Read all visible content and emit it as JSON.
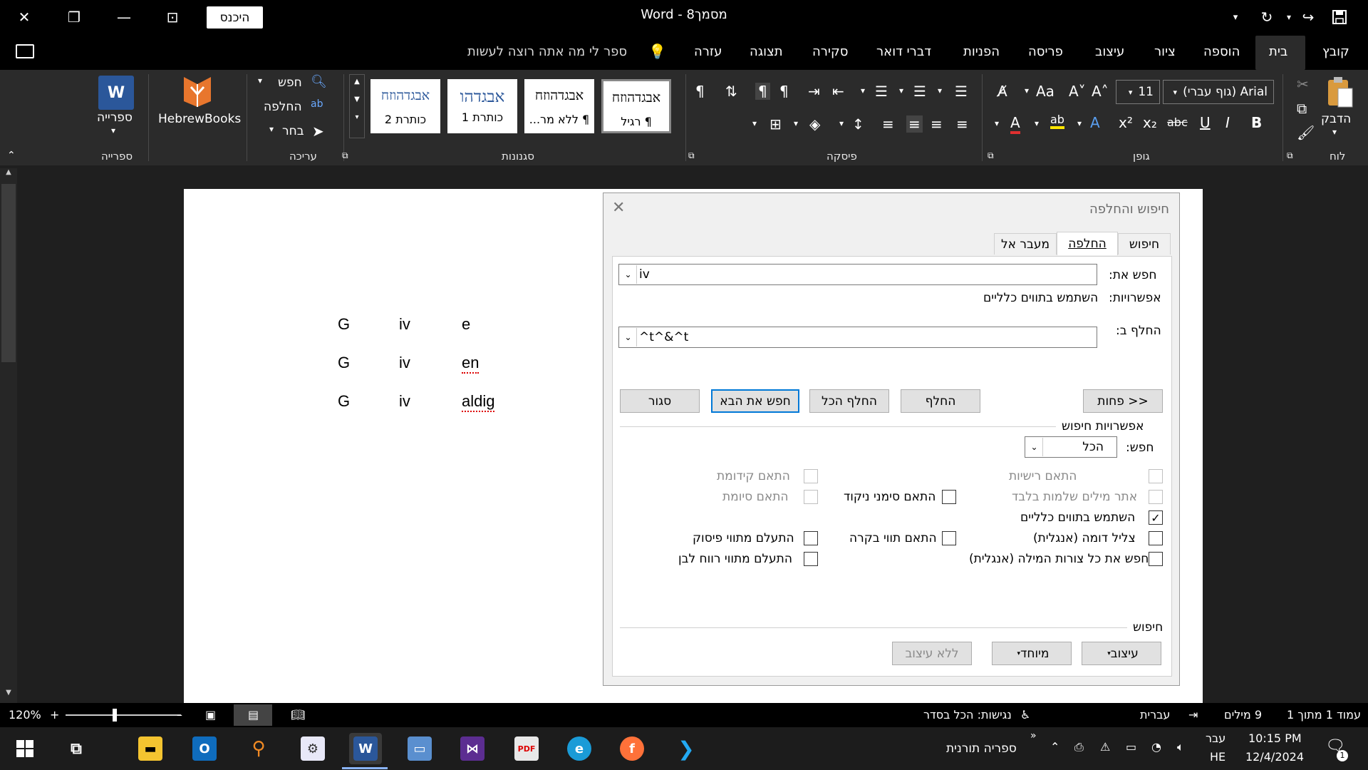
{
  "titlebar": {
    "signin": "היכנס",
    "title": "מסמך8  -  Word"
  },
  "tabs": {
    "file": "קובץ",
    "home": "בית",
    "insert": "הוספה",
    "draw": "ציור",
    "design": "עיצוב",
    "layout": "פריסה",
    "references": "הפניות",
    "mailings": "דברי דואר",
    "review": "סקירה",
    "view": "תצוגה",
    "help": "עזרה",
    "tellme": "ספר לי מה אתה רוצה לעשות"
  },
  "ribbon": {
    "groups": {
      "clipboard": "לוח",
      "font": "גופן",
      "paragraph": "פיסקה",
      "styles": "סגנונות",
      "editing": "עריכה",
      "library": "ספרייה"
    },
    "paste": "הדבק",
    "font_name": "Arial (גוף עברי)",
    "font_size": "11",
    "styles": [
      {
        "preview": "אבגדהוזח",
        "name": "¶ רגיל"
      },
      {
        "preview": "אבגדהוזח",
        "name": "¶ ללא מר..."
      },
      {
        "preview": "אבגדהו",
        "name": "כותרת 1"
      },
      {
        "preview": "אבגדהוזח",
        "name": "כותרת 2"
      }
    ],
    "find": "חפש",
    "replace": "החלפה",
    "select": "בחר",
    "hebrewbooks": "HebrewBooks",
    "library_btn": "ספרייה"
  },
  "document": {
    "rows": [
      [
        "G",
        "iv",
        "e"
      ],
      [
        "G",
        "iv",
        "en"
      ],
      [
        "G",
        "iv",
        "aldig"
      ]
    ]
  },
  "dialog": {
    "title": "חיפוש והחלפה",
    "tabs": {
      "find": "חיפוש",
      "replace": "החלפה",
      "goto": "מעבר אל"
    },
    "find_label": "חפש את:",
    "find_value": "iv",
    "options_label": "אפשרויות:",
    "options_value": "השתמש בתווים כלליים",
    "replace_label": "החלף ב:",
    "replace_value": "^t^&^t",
    "buttons": {
      "less": "<< פחות",
      "replace": "החלף",
      "replace_all": "החלף הכל",
      "find_next": "חפש את הבא",
      "close": "סגור"
    },
    "search_options_title": "אפשרויות חיפוש",
    "search_label": "חפש:",
    "search_value": "הכל",
    "checks": {
      "match_case": "התאם רישיות",
      "whole_words": "אתר מילים שלמות בלבד",
      "wildcards": "השתמש בתווים כלליים",
      "sounds_like": "צליל דומה (אנגלית)",
      "all_forms": "חפש את כל צורות המילה (אנגלית)",
      "match_prefix": "התאם קידומת",
      "match_suffix": "התאם סיומת",
      "match_punct": "התאם סימני ניקוד",
      "match_kashida": "התאם תווי בקרה",
      "ignore_punct": "התעלם מתווי פיסוק",
      "ignore_space": "התעלם מתווי רווח לבן"
    },
    "find_section": "חיפוש",
    "bottom": {
      "format": "עיצוב",
      "special": "מיוחד",
      "no_format": "ללא עיצוב"
    }
  },
  "status": {
    "page": "עמוד 1 מתוך 1",
    "words": "9 מילים",
    "language": "עברית",
    "accessibility": "נגישות: הכל בסדר",
    "zoom": "120%"
  },
  "taskbar": {
    "torah_lib": "ספריה תורנית",
    "lang1": "עבר",
    "lang2": "HE",
    "time": "10:15 PM",
    "date": "12/4/2024",
    "notif": "1"
  }
}
